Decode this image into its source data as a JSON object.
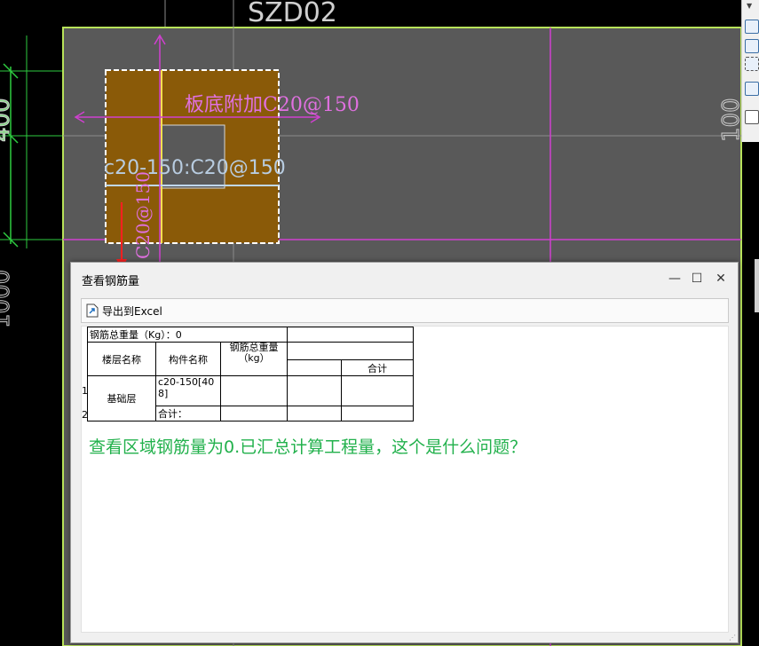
{
  "cad": {
    "top_label": "SZD02",
    "rebar_note": "板底附加C20@150",
    "rebar_spec": "c20-150:C20@150",
    "vertical_spec": "C20@150",
    "left_dim_top": "400",
    "left_dim_bottom": "1000",
    "right_dim": "100",
    "colors": {
      "background": "#000000",
      "area_fill": "#8a5a08",
      "grid_gray": "#6e6e6e",
      "magenta": "#e040e0",
      "cad_green": "#2ecc40",
      "lime_border": "#b8e35a"
    }
  },
  "dialog": {
    "title": "查看钢筋量",
    "minimize_icon": "minimize-icon",
    "maximize_icon": "maximize-icon",
    "close_icon": "close-icon",
    "export_label": "导出到Excel",
    "table": {
      "total_weight_label": "钢筋总重量（Kg）：0",
      "headers": {
        "floor_name": "楼层名称",
        "component_name": "构件名称",
        "rebar_total_weight": "钢筋总重量",
        "unit": "（kg）",
        "sum": "合计"
      },
      "row_numbers": [
        "1",
        "2"
      ],
      "rows": [
        {
          "floor": "基础层",
          "component": "c20-150[408]",
          "weight": "",
          "c1": "",
          "c2": ""
        },
        {
          "component": "合计：",
          "weight": "",
          "c1": "",
          "c2": ""
        }
      ]
    },
    "question": "查看区域钢筋量为0.已汇总计算工程量，这个是什么问题？",
    "question_color": "#22b14c"
  }
}
